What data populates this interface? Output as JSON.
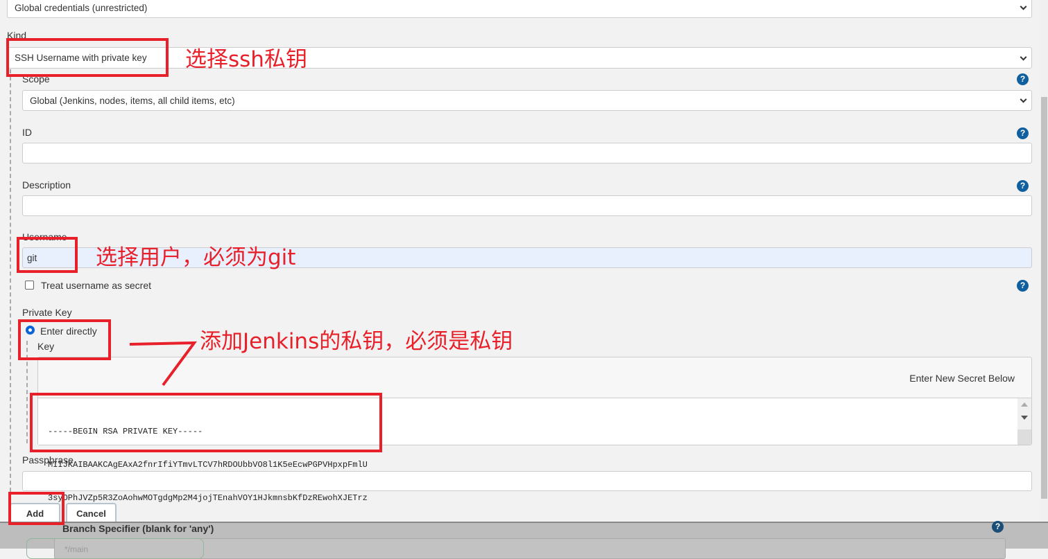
{
  "domain_select": {
    "value": "Global credentials (unrestricted)"
  },
  "kind": {
    "label": "Kind",
    "value": "SSH Username with private key"
  },
  "scope": {
    "label": "Scope",
    "value": "Global (Jenkins, nodes, items, all child items, etc)"
  },
  "id": {
    "label": "ID",
    "value": ""
  },
  "description": {
    "label": "Description",
    "value": ""
  },
  "username": {
    "label": "Username",
    "value": "git"
  },
  "treat_secret": {
    "label": "Treat username as secret",
    "checked": false
  },
  "private_key": {
    "label": "Private Key",
    "option": "Enter directly",
    "key_label": "Key",
    "secret_hint": "Enter New Secret Below",
    "lines": [
      "-----BEGIN RSA PRIVATE KEY-----",
      "MIIJKAIBAAKCAgEAxA2fnrIfiYTmvLTCV7hRDOUbbVO8l1K5eEcwPGPVHpxpFmlU",
      "3syOPhJVZp5R3ZoAohwMOTgdgMp2M4jojTEnahVOY1HJkmnsbKfDzREwohXJETrz"
    ]
  },
  "passphrase": {
    "label": "Passphrase",
    "value": ""
  },
  "buttons": {
    "add": "Add",
    "cancel": "Cancel"
  },
  "background": {
    "branch_label": "Branch Specifier (blank for 'any')",
    "branch_value": "*/main"
  },
  "annotations": {
    "kind": "选择ssh私钥",
    "username": "选择用户，必须为git",
    "key": "添加Jenkins的私钥，必须是私钥"
  },
  "colors": {
    "annotation": "#e8202a",
    "help": "#1060a0",
    "autofill": "#e8f0fe"
  }
}
